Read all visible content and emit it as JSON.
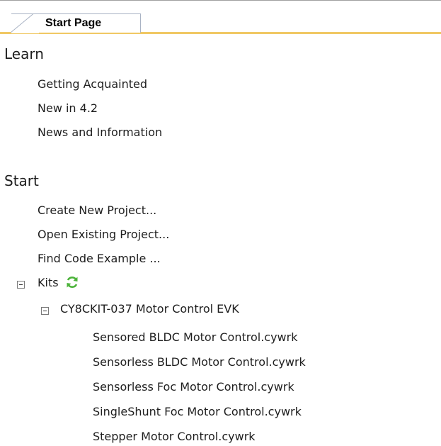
{
  "tab": {
    "label": "Start Page"
  },
  "learn": {
    "heading": "Learn",
    "items": [
      "Getting Acquainted",
      "New in 4.2",
      "News and Information"
    ]
  },
  "start": {
    "heading": "Start",
    "items": [
      "Create New Project...",
      "Open Existing Project...",
      "Find Code Example ..."
    ]
  },
  "kits": {
    "label": "Kits",
    "kit": {
      "label": "CY8CKIT-037 Motor Control EVK",
      "files": [
        "Sensored BLDC Motor Control.cywrk",
        "Sensorless BLDC Motor Control.cywrk",
        "Sensorless Foc Motor Control.cywrk",
        "SingleShunt Foc Motor Control.cywrk",
        "Stepper Motor Control.cywrk"
      ]
    }
  }
}
